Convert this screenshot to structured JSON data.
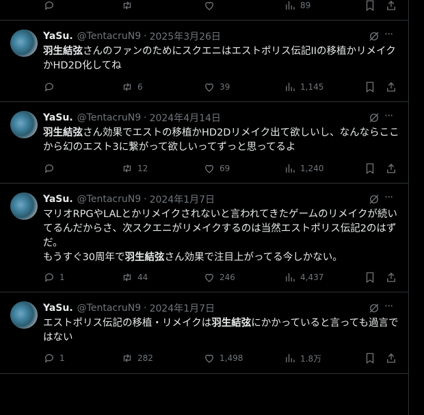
{
  "top_actions": {
    "views": "89"
  },
  "tweets": [
    {
      "name": "YaSu.",
      "handle": "@TentacruN9",
      "date": "2025年3月26日",
      "text_pre": "",
      "text_bold": "羽生結弦",
      "text_post": "さんのファンのためにスクエニはエストポリス伝記IIの移植かリメイクかHD2D化してね",
      "text_bold2": "",
      "text_post2": "",
      "replies": "",
      "retweets": "6",
      "likes": "39",
      "views": "1,145"
    },
    {
      "name": "YaSu.",
      "handle": "@TentacruN9",
      "date": "2024年4月14日",
      "text_pre": "",
      "text_bold": "羽生結弦",
      "text_post": "さん効果でエストの移植かHD2Dリメイク出て欲しいし、なんならここから幻のエスト3に繋がって欲しいってずっと思ってるよ",
      "text_bold2": "",
      "text_post2": "",
      "replies": "",
      "retweets": "12",
      "likes": "69",
      "views": "1,240"
    },
    {
      "name": "YaSu.",
      "handle": "@TentacruN9",
      "date": "2024年1月7日",
      "text_pre": "マリオRPGやLALとかリメイクされないと言われてきたゲームのリメイクが続いてるんだからさ、次スクエニがリメイクするのは当然エストポリス伝記2のはずだ。\nもうすぐ30周年で",
      "text_bold": "羽生結弦",
      "text_post": "さん効果で注目上がってる今しかない。",
      "text_bold2": "",
      "text_post2": "",
      "replies": "1",
      "retweets": "44",
      "likes": "246",
      "views": "4,437"
    },
    {
      "name": "YaSu.",
      "handle": "@TentacruN9",
      "date": "2024年1月7日",
      "text_pre": "エストポリス伝記の移植・リメイクは",
      "text_bold": "羽生結弦",
      "text_post": "にかかっていると言っても過言ではない",
      "text_bold2": "",
      "text_post2": "",
      "replies": "1",
      "retweets": "282",
      "likes": "1,498",
      "views": "1.8万"
    }
  ]
}
